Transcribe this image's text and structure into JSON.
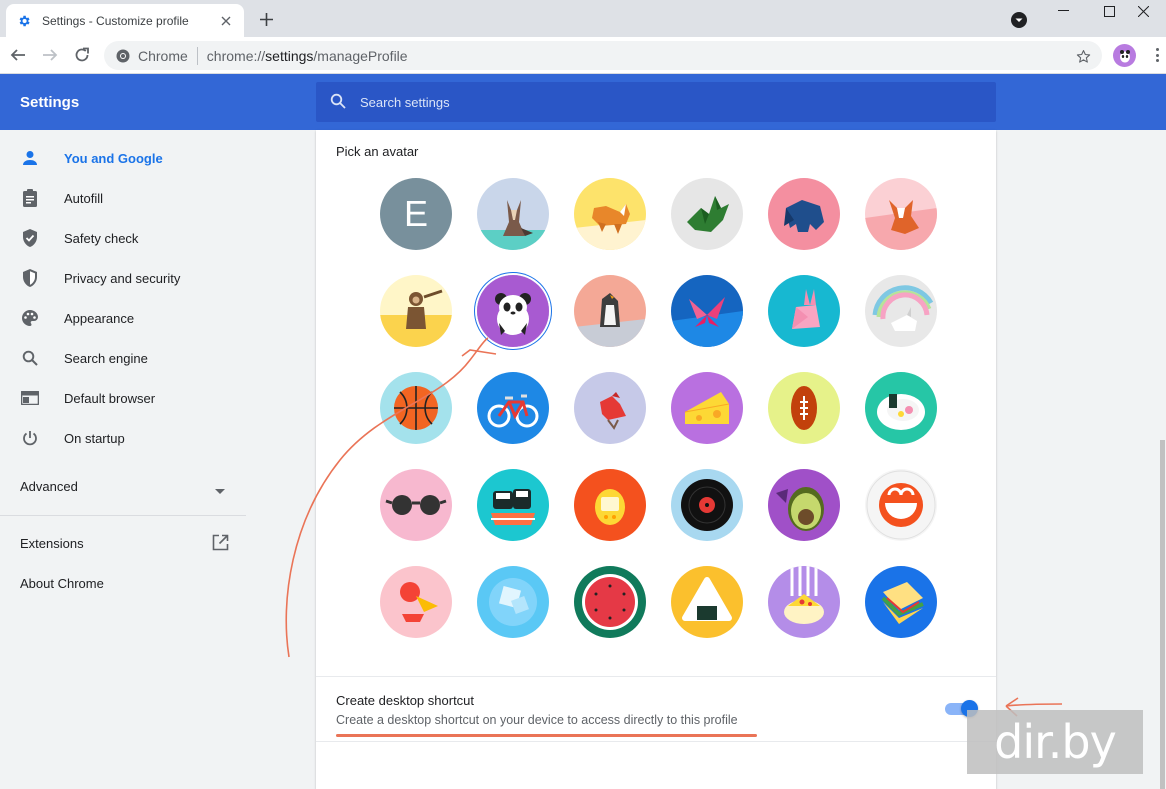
{
  "tab": {
    "title": "Settings - Customize profile",
    "favicon": "gear-icon"
  },
  "toolbar": {
    "site_label": "Chrome",
    "url_host": "chrome://",
    "url_bold": "settings",
    "url_path": "/manageProfile"
  },
  "header": {
    "title": "Settings",
    "search_placeholder": "Search settings"
  },
  "sidebar": {
    "items": [
      {
        "label": "You and Google",
        "icon": "person-icon",
        "active": true
      },
      {
        "label": "Autofill",
        "icon": "clipboard-icon"
      },
      {
        "label": "Safety check",
        "icon": "shield-check-icon"
      },
      {
        "label": "Privacy and security",
        "icon": "shield-icon"
      },
      {
        "label": "Appearance",
        "icon": "palette-icon"
      },
      {
        "label": "Search engine",
        "icon": "search-icon"
      },
      {
        "label": "Default browser",
        "icon": "browser-icon"
      },
      {
        "label": "On startup",
        "icon": "power-icon"
      }
    ],
    "advanced": "Advanced",
    "extensions": "Extensions",
    "about": "About Chrome"
  },
  "main": {
    "pick_avatar_label": "Pick an avatar",
    "default_avatar_letter": "E",
    "selected_avatar": "panda",
    "avatars": [
      "letter-e",
      "cat",
      "corgi",
      "dragon",
      "elephant",
      "fox",
      "monkey",
      "panda",
      "penguin",
      "butterfly",
      "rabbit",
      "unicorn",
      "basketball",
      "bicycle",
      "bird",
      "cheese",
      "football",
      "ramen",
      "sunglasses",
      "sushi",
      "tamagotchi",
      "vinyl-record",
      "avocado",
      "smiley",
      "ice-cream",
      "ice-cube",
      "watermelon",
      "onigiri",
      "pizza",
      "sandwich"
    ],
    "shortcut": {
      "title": "Create desktop shortcut",
      "description": "Create a desktop shortcut on your device to access directly to this profile",
      "enabled": true
    }
  },
  "watermark": "dir.by",
  "colors": {
    "header": "#3367d6",
    "accent": "#1a73e8",
    "annotation": "#ea7457"
  }
}
